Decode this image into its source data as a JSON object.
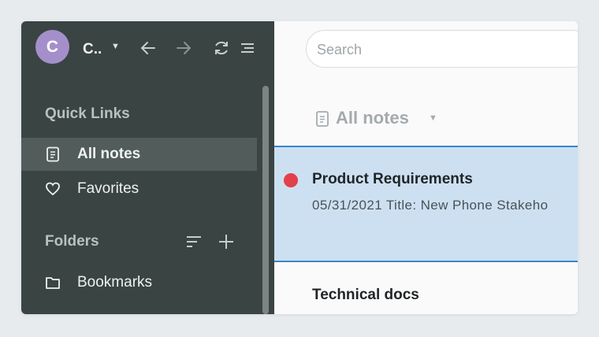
{
  "account": {
    "initial": "C",
    "name": "C..",
    "avatar_color": "#a58fca"
  },
  "toolbar": {
    "icons": [
      "back-arrow-icon",
      "forward-arrow-icon",
      "sync-icon",
      "menu-icon"
    ]
  },
  "sidebar": {
    "quick_links_title": "Quick Links",
    "items": [
      {
        "label": "All notes",
        "icon": "note-icon",
        "active": true
      },
      {
        "label": "Favorites",
        "icon": "heart-icon",
        "active": false
      }
    ],
    "folders_title": "Folders",
    "folders": [
      {
        "label": "Bookmarks",
        "icon": "folder-icon"
      }
    ],
    "colors": {
      "background": "#3a4443",
      "active": "#525c5b"
    }
  },
  "search": {
    "placeholder": "Search"
  },
  "list": {
    "header": "All notes",
    "notes": [
      {
        "title": "Product Requirements",
        "snippet": "05/31/2021 Title: New Phone Stakeho",
        "selected": true,
        "dot_color": "#e2404a"
      },
      {
        "title": "Technical docs",
        "snippet": "",
        "selected": false
      }
    ],
    "colors": {
      "selected_bg": "#cde0f2",
      "selected_border": "#3a86c8"
    }
  }
}
